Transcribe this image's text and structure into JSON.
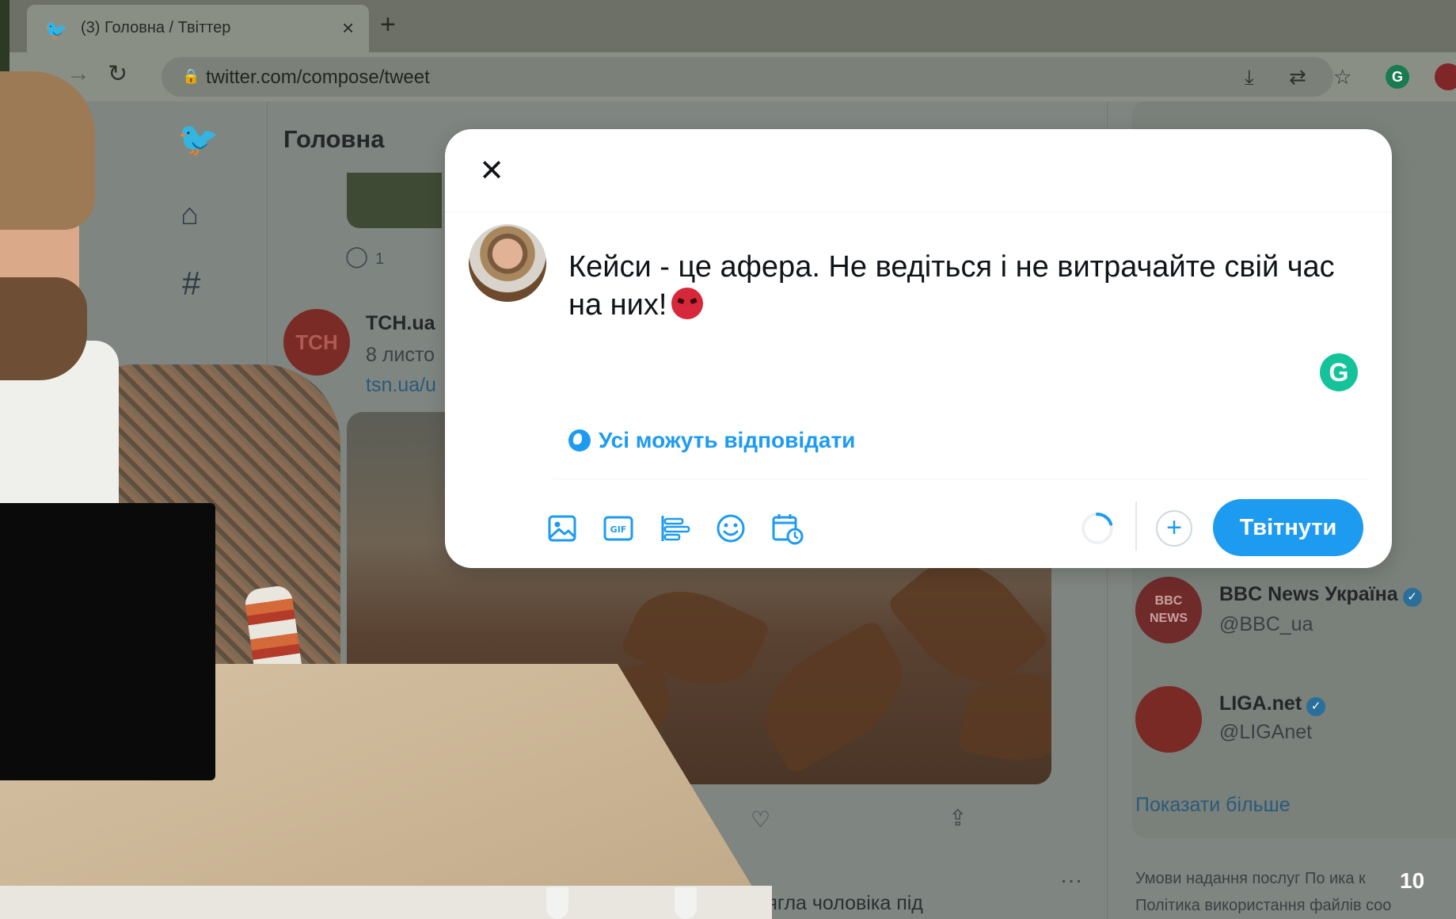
{
  "browser": {
    "tab_title": "(3) Головна / Твіттер",
    "tab_close": "×",
    "new_tab": "+",
    "url": "twitter.com/compose/tweet",
    "icons": [
      "back-arrow-icon",
      "forward-arrow-icon",
      "reload-icon",
      "lock-icon",
      "install-icon",
      "translate-icon",
      "star-icon",
      "grammarly-extension-icon",
      "abbyy-extension-icon"
    ]
  },
  "feed": {
    "title": "Головна",
    "reply_count": "1",
    "tsn_avatar_text": "ТСН",
    "tsn_name": "ТСН.ua",
    "tsn_date": "8 листо",
    "tsn_link": "tsn.ua/u",
    "bottom_news": "Залишилися лише   уляри:     ралії біла акула затягла чоловіка під"
  },
  "sidebar": {
    "accounts": [
      {
        "avatar_text": "BBC NEWS",
        "name": "BBC News Україна",
        "handle": "@BBC_ua"
      },
      {
        "avatar_text": "",
        "name": "LIGA.net",
        "handle": "@LIGAnet"
      }
    ],
    "show_more": "Показати більше",
    "footer_line1": "Умови надання послуг   По   ика к",
    "footer_line2": "Політика використання файлів coo"
  },
  "slide": {
    "page_number": "10"
  },
  "compose": {
    "close_label": "✕",
    "tweet_text": "Кейси - це афера. Не ведіться і не витрачайте свій час на них!",
    "grammarly_label": "G",
    "reply_setting": "Усі можуть відповідати",
    "add_thread_label": "+",
    "tweet_button": "Твітнути",
    "gif_label": "GIF",
    "progress": 0.2,
    "colors": {
      "accent": "#1d9bf0",
      "grammarly": "#15c39a",
      "emoji": "#d6283a"
    }
  }
}
